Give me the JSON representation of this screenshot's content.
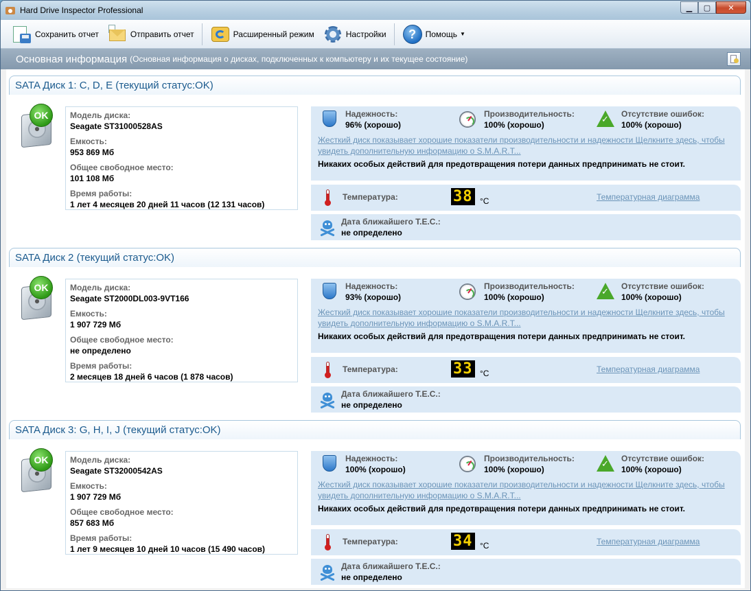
{
  "window": {
    "title": "Hard Drive Inspector Professional",
    "buttons": {
      "minimize": "▁",
      "maximize": "▢",
      "close": "✕"
    }
  },
  "toolbar": {
    "save_report": "Сохранить отчет",
    "send_report": "Отправить отчет",
    "advanced_mode": "Расширенный режим",
    "settings": "Настройки",
    "help": "Помощь",
    "help_caret": "▼",
    "help_glyph": "?"
  },
  "header": {
    "title": "Основная информация",
    "subtitle": "(Основная информация о дисках, подключенных к компьютеру и  их текущее состояние)"
  },
  "labels": {
    "ok": "OK",
    "model": "Модель диска:",
    "capacity": "Емкость:",
    "free": "Общее свободное место:",
    "uptime": "Время работы:",
    "reliability": "Надежность:",
    "performance": "Производительность:",
    "no_errors": "Отсутствие ошибок:",
    "smart_link": "Жесткий диск показывает хорошие показатели производительности и надежности Щелкните здесь, чтобы увидеть дополнительную информацию о S.M.A.R.T...",
    "advice": "Никаких особых действий для предотвращения потери данных предпринимать не стоит.",
    "temperature": "Температура:",
    "celsius": "°C",
    "temp_chart": "Температурная диаграмма",
    "tec": "Дата ближайшего T.E.C.:"
  },
  "disks": [
    {
      "title": "SATA Диск 1: C, D, E (текущий статус:OK)",
      "model": "Seagate ST31000528AS",
      "capacity": "953 869 Мб",
      "free": "101 108 Мб",
      "uptime": "1 лет 4 месяцев 20 дней 11 часов (12 131 часов)",
      "reliability": "96% (хорошо)",
      "performance": "100% (хорошо)",
      "no_errors": "100% (хорошо)",
      "temperature": "38",
      "tec": "не определено"
    },
    {
      "title": "SATA Диск 2 (текущий статус:OK)",
      "model": "Seagate ST2000DL003-9VT166",
      "capacity": "1 907 729 Мб",
      "free": "не определено",
      "uptime": "2 месяцев 18 дней 6 часов (1 878 часов)",
      "reliability": "93% (хорошо)",
      "performance": "100% (хорошо)",
      "no_errors": "100% (хорошо)",
      "temperature": "33",
      "tec": "не определено"
    },
    {
      "title": "SATA Диск 3: G, H, I, J (текущий статус:OK)",
      "model": "Seagate ST32000542AS",
      "capacity": "1 907 729 Мб",
      "free": "857 683 Мб",
      "uptime": "1 лет 9 месяцев 10 дней 10 часов (15 490 часов)",
      "reliability": "100% (хорошо)",
      "performance": "100% (хорошо)",
      "no_errors": "100% (хорошо)",
      "temperature": "34",
      "tec": "не определено"
    }
  ]
}
